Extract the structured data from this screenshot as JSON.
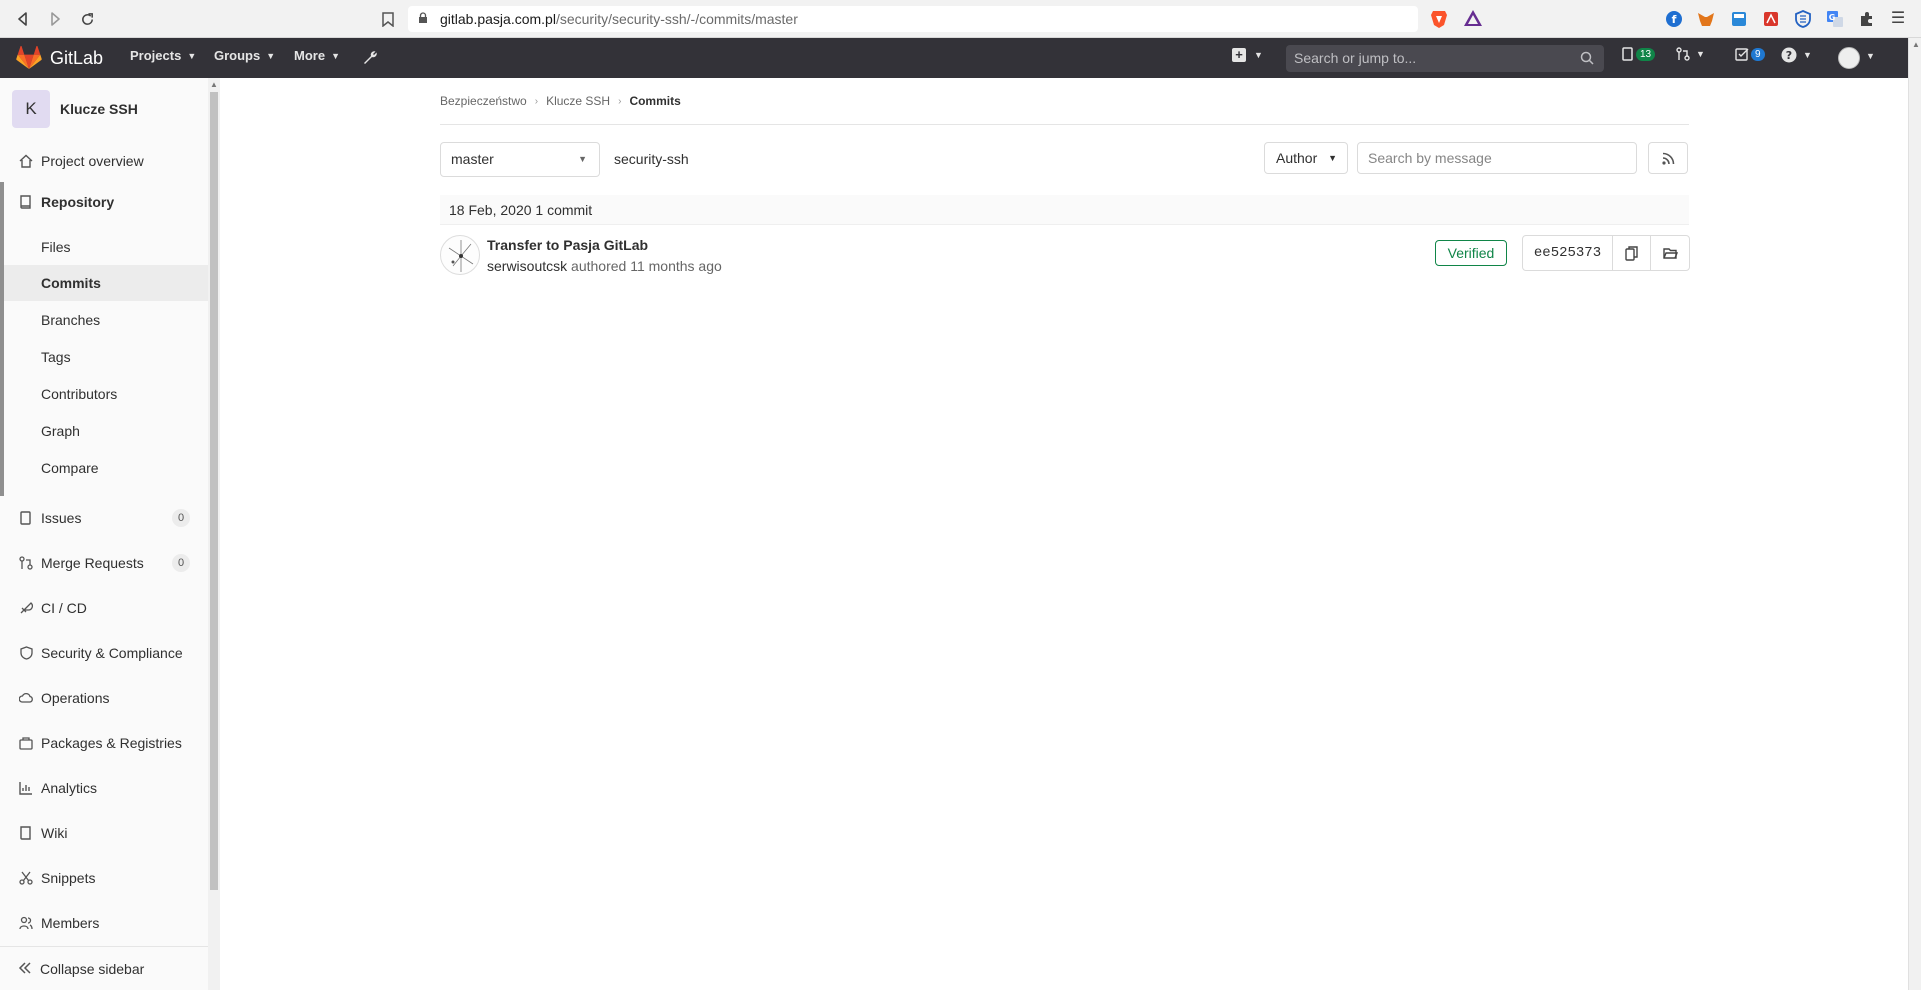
{
  "browser": {
    "url_host": "gitlab.pasja.com.pl",
    "url_path": "/security/security-ssh/-/commits/master"
  },
  "topnav": {
    "brand": "GitLab",
    "projects": "Projects",
    "groups": "Groups",
    "more": "More",
    "search_placeholder": "Search or jump to...",
    "mr_count": "13",
    "todo_count": "9"
  },
  "sidebar": {
    "project_initial": "K",
    "project_name": "Klucze SSH",
    "items": {
      "overview": "Project overview",
      "repository": "Repository",
      "issues": "Issues",
      "issues_count": "0",
      "merge_requests": "Merge Requests",
      "mr_count": "0",
      "cicd": "CI / CD",
      "security": "Security & Compliance",
      "operations": "Operations",
      "packages": "Packages & Registries",
      "analytics": "Analytics",
      "wiki": "Wiki",
      "snippets": "Snippets",
      "members": "Members"
    },
    "repo_sub": {
      "files": "Files",
      "commits": "Commits",
      "branches": "Branches",
      "tags": "Tags",
      "contributors": "Contributors",
      "graph": "Graph",
      "compare": "Compare"
    },
    "collapse": "Collapse sidebar"
  },
  "breadcrumbs": {
    "group": "Bezpieczeństwo",
    "project": "Klucze SSH",
    "current": "Commits"
  },
  "toolbar": {
    "branch": "master",
    "repo_path": "security-ssh",
    "author": "Author",
    "search_placeholder": "Search by message"
  },
  "commits": {
    "day_header": "18 Feb, 2020 1 commit",
    "items": [
      {
        "title": "Transfer to Pasja GitLab",
        "author": "serwisoutcsk",
        "action": "authored",
        "time": "11 months ago",
        "status": "Verified",
        "sha": "ee525373"
      }
    ]
  },
  "colors": {
    "topnav_bg": "#333238",
    "verified": "#108548",
    "mr_badge": "#108548",
    "todo_badge": "#1f78d1",
    "project_avatar_bg": "#e1dbf1"
  }
}
